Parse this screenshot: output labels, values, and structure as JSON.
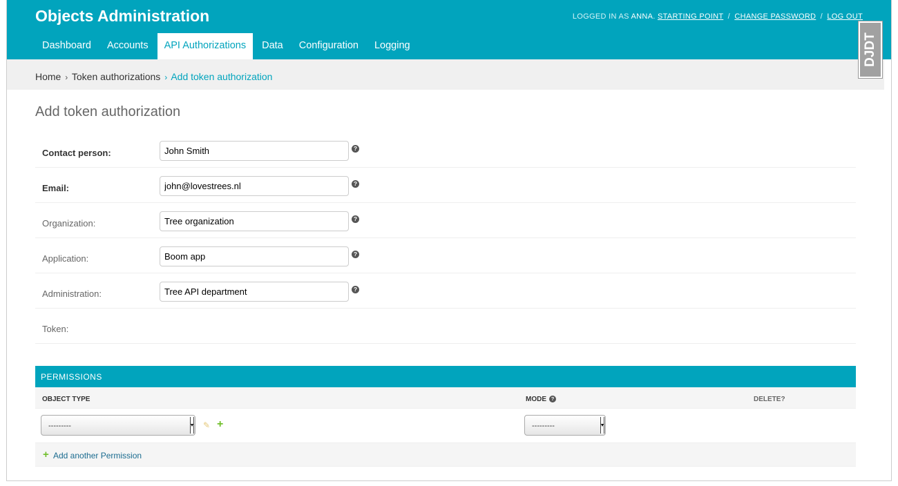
{
  "header": {
    "title": "Objects Administration",
    "user_tools": {
      "logged_in_prefix": "LOGGED IN AS",
      "username": "ANNA",
      "links": [
        "STARTING POINT",
        "CHANGE PASSWORD",
        "LOG OUT"
      ],
      "separator": "/"
    },
    "nav": [
      {
        "label": "Dashboard",
        "active": false
      },
      {
        "label": "Accounts",
        "active": false
      },
      {
        "label": "API Authorizations",
        "active": true
      },
      {
        "label": "Data",
        "active": false
      },
      {
        "label": "Configuration",
        "active": false
      },
      {
        "label": "Logging",
        "active": false
      }
    ]
  },
  "breadcrumbs": {
    "home": "Home",
    "section": "Token authorizations",
    "current": "Add token authorization",
    "separator": "›"
  },
  "page_title": "Add token authorization",
  "form": {
    "fields": [
      {
        "label": "Contact person:",
        "value": "John Smith",
        "required": true
      },
      {
        "label": "Email:",
        "value": "john@lovestrees.nl",
        "required": true
      },
      {
        "label": "Organization:",
        "value": "Tree organization",
        "required": false
      },
      {
        "label": "Application:",
        "value": "Boom app",
        "required": false
      },
      {
        "label": "Administration:",
        "value": "Tree API department",
        "required": false
      }
    ],
    "token_label": "Token:"
  },
  "permissions": {
    "title": "PERMISSIONS",
    "columns": {
      "object_type": "OBJECT TYPE",
      "mode": "MODE",
      "delete": "DELETE?"
    },
    "row": {
      "object_type_value": "---------",
      "mode_value": "---------"
    },
    "add_another": "Add another Permission"
  },
  "debug_toolbar": {
    "label": "DJDT"
  },
  "colors": {
    "primary": "#01a4bd",
    "add_green": "#70bf2b",
    "link": "#1a6b8f"
  }
}
